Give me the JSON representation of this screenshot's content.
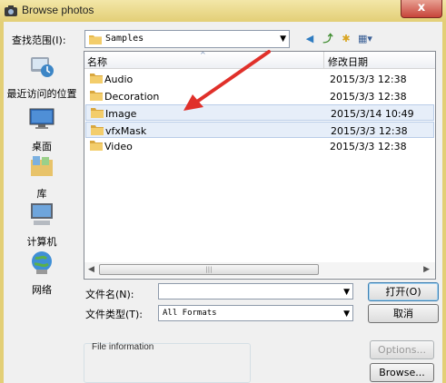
{
  "window": {
    "title": "Browse photos",
    "close_glyph": "x"
  },
  "lookin": {
    "label": "查找范围(I):",
    "value": "Samples",
    "arrow": "▼"
  },
  "toolbar": [
    {
      "name": "back-icon",
      "glyph": "◀",
      "color": "#2f7cc1"
    },
    {
      "name": "up-folder-icon",
      "glyph": "⤴",
      "color": "#3a8a2a"
    },
    {
      "name": "new-folder-icon",
      "glyph": "✱",
      "color": "#d9a521"
    },
    {
      "name": "view-menu-icon",
      "glyph": "▦▾",
      "color": "#3a5f95"
    }
  ],
  "places": [
    {
      "id": "recent",
      "label": "最近访问的位置",
      "icon": "recent-places-icon"
    },
    {
      "id": "desktop",
      "label": "桌面",
      "icon": "desktop-icon"
    },
    {
      "id": "libraries",
      "label": "库",
      "icon": "library-icon"
    },
    {
      "id": "computer",
      "label": "计算机",
      "icon": "computer-icon"
    },
    {
      "id": "network",
      "label": "网络",
      "icon": "network-icon"
    }
  ],
  "columns": {
    "name": "名称",
    "date": "修改日期",
    "sort_glyph": "^"
  },
  "files": [
    {
      "name": "Audio",
      "date": "2015/3/3 12:38",
      "selected": false
    },
    {
      "name": "Decoration",
      "date": "2015/3/3 12:38",
      "selected": false
    },
    {
      "name": "Image",
      "date": "2015/3/14 10:49",
      "selected": true
    },
    {
      "name": "vfxMask",
      "date": "2015/3/3 12:38",
      "selected": true
    },
    {
      "name": "Video",
      "date": "2015/3/3 12:38",
      "selected": false
    }
  ],
  "scroll": {
    "left": "◀",
    "right": "▶",
    "grip": "|||"
  },
  "filename": {
    "label": "文件名(N):",
    "value": "",
    "arrow": "▼"
  },
  "filetype": {
    "label": "文件类型(T):",
    "value": "All Formats",
    "arrow": "▼"
  },
  "buttons": {
    "open": "打开(O)",
    "cancel": "取消",
    "options": "Options...",
    "browse": "Browse..."
  },
  "info": {
    "label": "File information"
  },
  "colors": {
    "annotation_arrow": "#e0302a",
    "folder": "#e8b94a",
    "selection": "#e6eef9"
  }
}
